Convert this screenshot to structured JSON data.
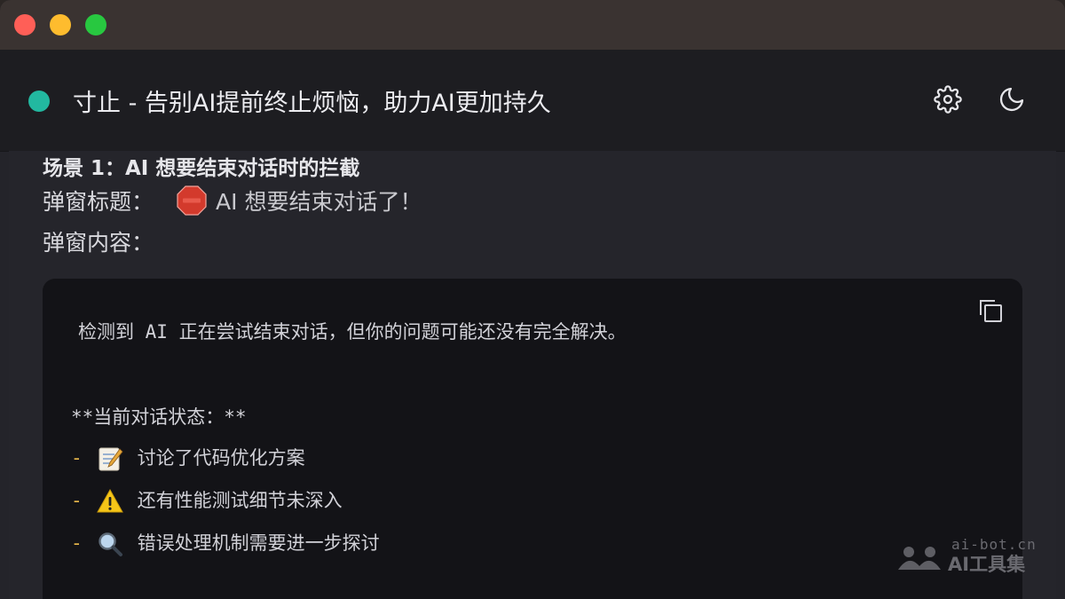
{
  "header": {
    "title": "寸止 - 告别AI提前终止烦恼，助力AI更加持久",
    "status_color": "#22b8a0",
    "icons": [
      "gear-icon",
      "moon-icon"
    ]
  },
  "content": {
    "scene_heading": "场景 1：AI 想要结束对话时的拦截",
    "popup_title_label": "弹窗标题：",
    "popup_title_text": "AI 想要结束对话了！",
    "popup_title_icon": "stop-sign-icon",
    "popup_content_label": "弹窗内容："
  },
  "code_block": {
    "intro": "检测到 AI 正在尝试结束对话，但你的问题可能还没有完全解决。",
    "status_heading": "**当前对话状态：**",
    "items": [
      {
        "dash": "-",
        "icon": "memo-icon",
        "text": "讨论了代码优化方案"
      },
      {
        "dash": "-",
        "icon": "warning-icon",
        "text": "还有性能测试细节未深入"
      },
      {
        "dash": "-",
        "icon": "magnifier-icon",
        "text": "错误处理机制需要进一步探讨"
      }
    ]
  },
  "watermark": {
    "domain": "ai-bot.cn",
    "brand": "AI工具集"
  }
}
